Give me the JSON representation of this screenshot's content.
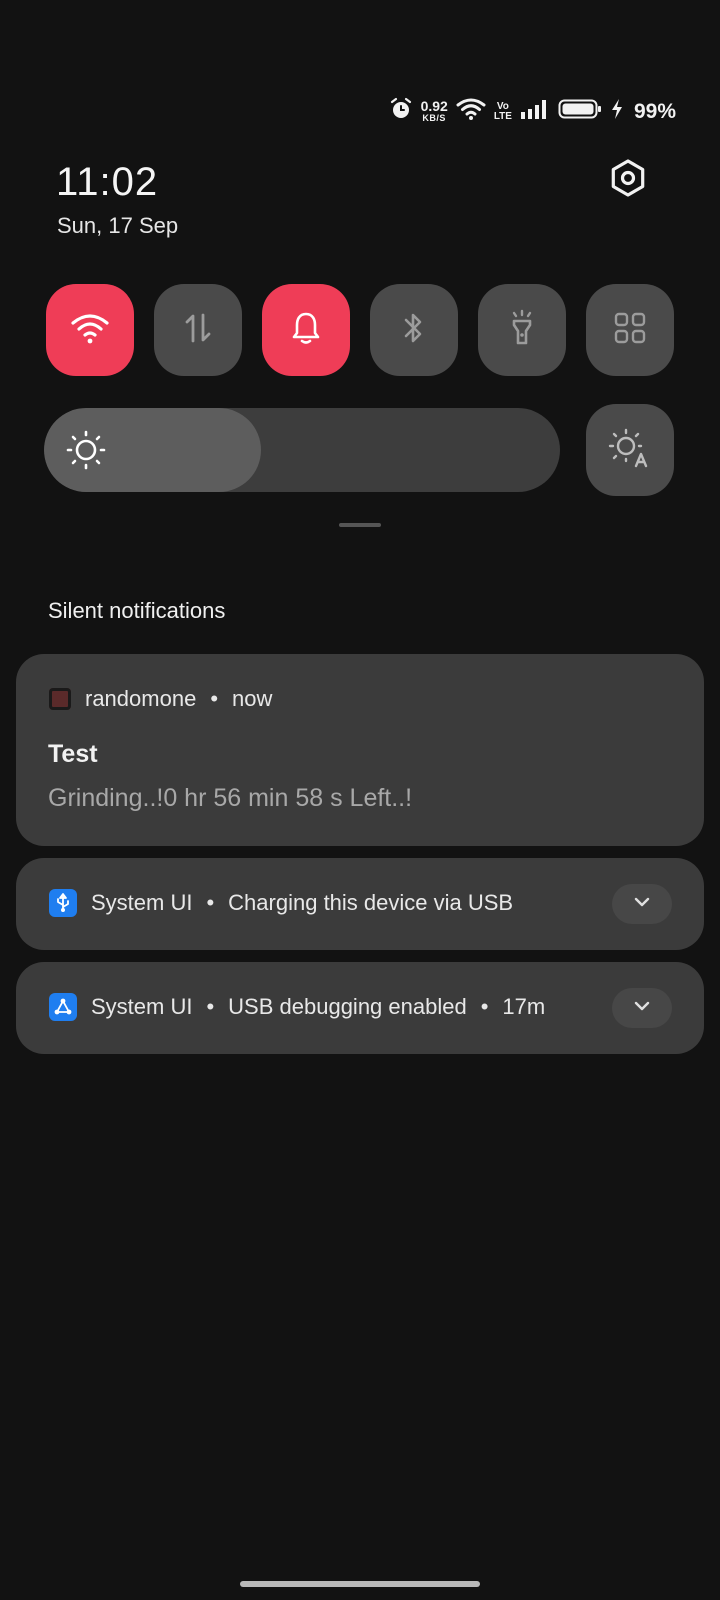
{
  "status_bar": {
    "net_speed_value": "0.92",
    "net_speed_unit": "KB/S",
    "volte_top": "Vo",
    "volte_bottom": "LTE",
    "battery_percent": "99%"
  },
  "header": {
    "time": "11:02",
    "date": "Sun, 17 Sep"
  },
  "quick_tiles": [
    {
      "icon": "wifi-icon",
      "active": true
    },
    {
      "icon": "mobile-data-icon",
      "active": false
    },
    {
      "icon": "bell-icon",
      "active": true
    },
    {
      "icon": "bluetooth-icon",
      "active": false
    },
    {
      "icon": "flashlight-icon",
      "active": false
    },
    {
      "icon": "grid-icon",
      "active": false
    }
  ],
  "brightness": {
    "level_fraction": 0.42,
    "auto_icon": "auto-brightness-icon"
  },
  "colors": {
    "accent": "#ef3d57",
    "tile_inactive": "#4a4a4a",
    "card": "#3b3b3b",
    "usb_blue": "#1f7ef0"
  },
  "notifications": {
    "section_title": "Silent notifications",
    "items": [
      {
        "app": "randomone",
        "separator": "•",
        "time": "now",
        "title": "Test",
        "body": "Grinding..!0 hr 56 min 58 s Left..!"
      },
      {
        "app": "System UI",
        "separator": "•",
        "text": "Charging this device via USB"
      },
      {
        "app": "System UI",
        "separator": "•",
        "text": "USB debugging enabled",
        "separator2": "•",
        "time": "17m"
      }
    ]
  }
}
